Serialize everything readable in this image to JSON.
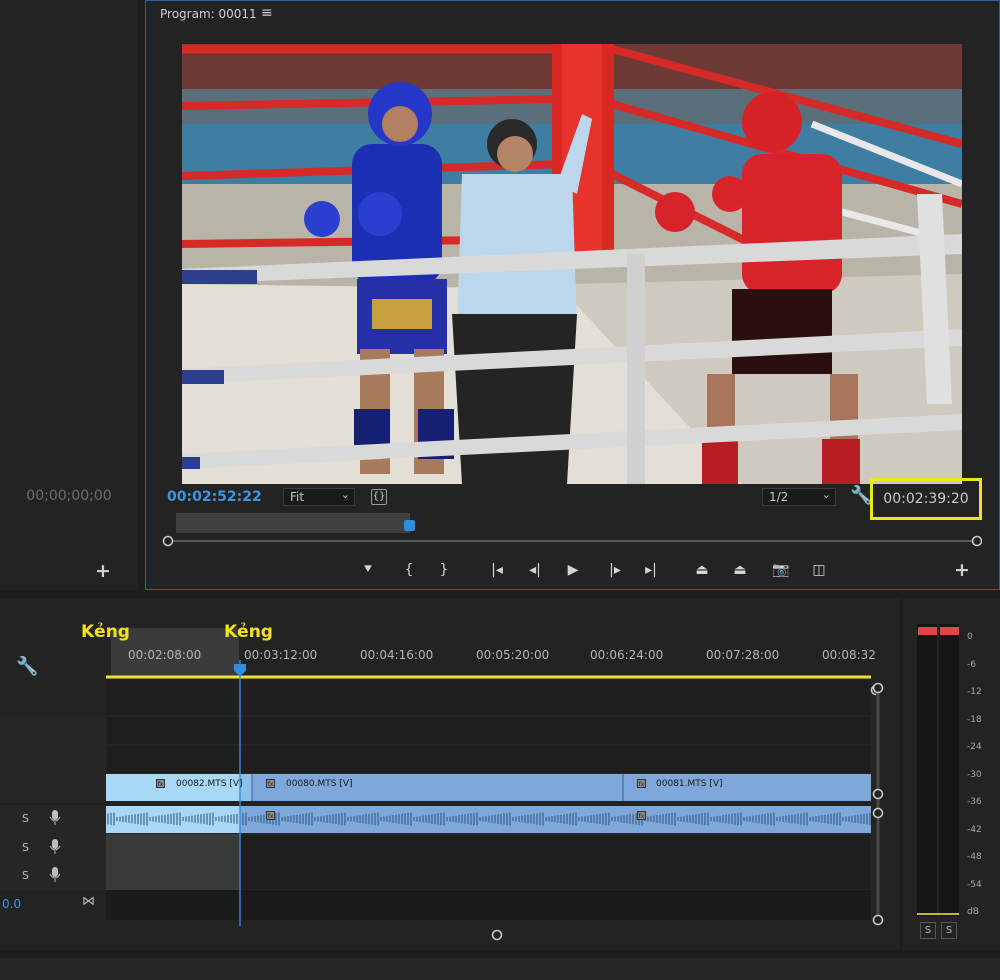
{
  "source_panel": {
    "timecode": "00;00;00;00",
    "add_label": "+"
  },
  "program": {
    "title": "Program: 00011",
    "menu_icon": "hamburger-icon",
    "playhead_timecode": "00:02:52:22",
    "zoom_value": "Fit",
    "resolution_value": "1/2",
    "duration_timecode": "00:02:39:20",
    "highlight_color": "#f0e51c",
    "accent_color": "#3b97e6",
    "add_label": "+",
    "transport_buttons": [
      {
        "name": "add-marker-button",
        "glyph": "⯆",
        "icon": "marker-icon"
      },
      {
        "name": "mark-in-button",
        "glyph": "{",
        "icon": "mark-in-icon"
      },
      {
        "name": "mark-out-button",
        "glyph": "}",
        "icon": "mark-out-icon"
      },
      {
        "name": "go-to-in-button",
        "glyph": "|◂",
        "icon": "go-to-in-icon"
      },
      {
        "name": "step-back-button",
        "glyph": "◂|",
        "icon": "step-back-icon"
      },
      {
        "name": "play-button",
        "glyph": "▶",
        "icon": "play-icon"
      },
      {
        "name": "step-forward-button",
        "glyph": "|▸",
        "icon": "step-forward-icon"
      },
      {
        "name": "go-to-out-button",
        "glyph": "▸|",
        "icon": "go-to-out-icon"
      },
      {
        "name": "lift-button",
        "glyph": "⏏",
        "icon": "lift-icon"
      },
      {
        "name": "extract-button",
        "glyph": "⏏",
        "icon": "extract-icon"
      },
      {
        "name": "export-frame-button",
        "glyph": "📷",
        "icon": "camera-icon"
      },
      {
        "name": "comparison-view-button",
        "glyph": "◫",
        "icon": "comparison-icon"
      }
    ]
  },
  "timeline": {
    "ruler_labels": [
      "00:02:08:00",
      "00:03:12:00",
      "00:04:16:00",
      "00:05:20:00",
      "00:06:24:00",
      "00:07:28:00",
      "00:08:32"
    ],
    "markers": [
      "Kẻng",
      "Kẻng"
    ],
    "partial_timecode": "0.0",
    "audio_track_solo_label": "S",
    "video_clips": [
      {
        "name": "00082.MTS [V]"
      },
      {
        "name": "00080.MTS [V]"
      },
      {
        "name": "00081.MTS [V]"
      }
    ],
    "fx_label": "fx",
    "clip_color": "#7ea8da",
    "selected_clip_color": "#a7d8f5",
    "work_area_color": "#ece23a"
  },
  "meter": {
    "scale": [
      "0",
      "-6",
      "-12",
      "-18",
      "-24",
      "-30",
      "-36",
      "-42",
      "-48",
      "-54",
      "dB"
    ],
    "solo_labels": [
      "S",
      "S"
    ],
    "peak_color": "#e04646"
  }
}
